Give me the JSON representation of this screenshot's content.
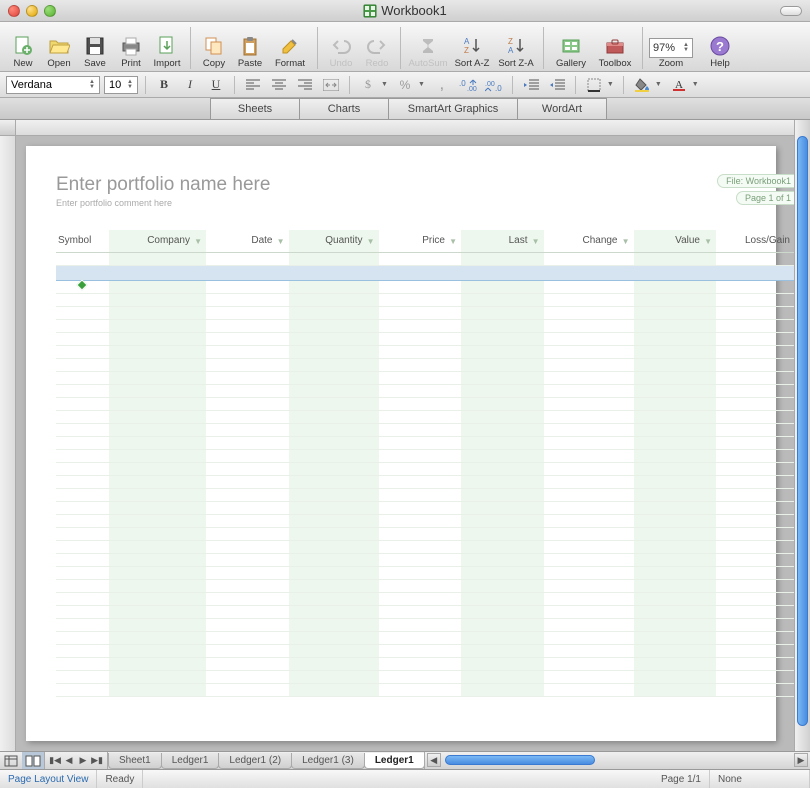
{
  "window": {
    "title": "Workbook1"
  },
  "toolbar": {
    "items": [
      {
        "label": "New",
        "group": 0
      },
      {
        "label": "Open",
        "group": 0
      },
      {
        "label": "Save",
        "group": 0
      },
      {
        "label": "Print",
        "group": 0
      },
      {
        "label": "Import",
        "group": 0
      },
      {
        "label": "Copy",
        "group": 1
      },
      {
        "label": "Paste",
        "group": 1
      },
      {
        "label": "Format",
        "group": 1
      },
      {
        "label": "Undo",
        "group": 2,
        "disabled": true
      },
      {
        "label": "Redo",
        "group": 2,
        "disabled": true
      },
      {
        "label": "AutoSum",
        "group": 3,
        "disabled": true
      },
      {
        "label": "Sort A-Z",
        "group": 3
      },
      {
        "label": "Sort Z-A",
        "group": 3
      },
      {
        "label": "Gallery",
        "group": 4
      },
      {
        "label": "Toolbox",
        "group": 4
      },
      {
        "label": "Help",
        "group": 5
      }
    ],
    "zoom_value": "97%",
    "zoom_label": "Zoom"
  },
  "formatting": {
    "font_name": "Verdana",
    "font_size": "10"
  },
  "category_tabs": [
    "Sheets",
    "Charts",
    "SmartArt Graphics",
    "WordArt"
  ],
  "portfolio": {
    "title_placeholder": "Enter portfolio name here",
    "comment_placeholder": "Enter portfolio comment here",
    "file_badge": "File: Workbook1",
    "page_badge": "Page 1 of 1",
    "columns": [
      "Symbol",
      "Company",
      "Date",
      "Quantity",
      "Price",
      "Last",
      "Change",
      "Value",
      "Loss/Gain"
    ]
  },
  "sheet_tabs": [
    {
      "name": "Sheet1",
      "active": false
    },
    {
      "name": "Ledger1",
      "active": false
    },
    {
      "name": "Ledger1 (2)",
      "active": false
    },
    {
      "name": "Ledger1 (3)",
      "active": false
    },
    {
      "name": "Ledger1",
      "active": true
    }
  ],
  "status": {
    "view_label": "Page Layout View",
    "ready": "Ready",
    "page": "Page 1/1",
    "none": "None"
  }
}
